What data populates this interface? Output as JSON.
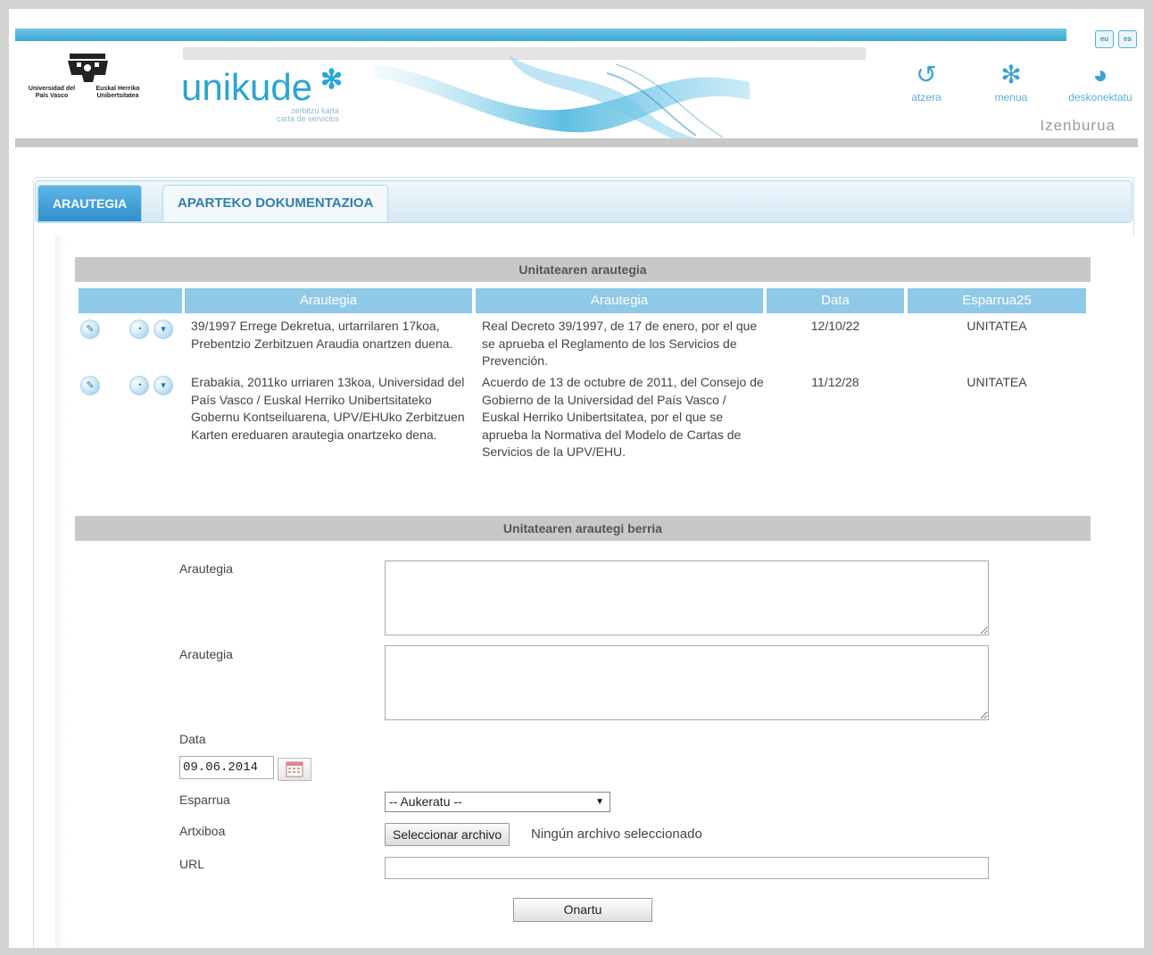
{
  "header": {
    "brand": "unikude",
    "brand_sub_1": "zerbitzu karta",
    "brand_sub_2": "carta de servicios",
    "ehu_text_1": "Universidad del País Vasco",
    "ehu_text_2": "Euskal Herriko Unibertsitatea",
    "lang_eu": "eu",
    "lang_es": "es",
    "nav": [
      {
        "label": "atzera",
        "icon": "back-arrow-icon"
      },
      {
        "label": "menua",
        "icon": "asterisk-menu-icon"
      },
      {
        "label": "deskonektatu",
        "icon": "globe-disconnect-icon"
      }
    ],
    "izenburua": "Izenburua",
    "accent": "#2aa5d5"
  },
  "tabs": [
    {
      "label": "ARAUTEGIA",
      "active": true
    },
    {
      "label": "APARTEKO DOKUMENTAZIOA",
      "active": false
    }
  ],
  "list": {
    "title": "Unitatearen arautegia",
    "columns": [
      "Arautegia",
      "Arautegia",
      "Data",
      "Esparrua25"
    ],
    "rows": [
      {
        "eu": "39/1997 Errege Dekretua, urtarrilaren 17koa, Prebentzio Zerbitzuen Araudia onartzen duena.",
        "es": "Real Decreto 39/1997, de 17 de enero, por el que se aprueba el Reglamento de los Servicios de Prevención.",
        "date": "12/10/22",
        "scope": "UNITATEA"
      },
      {
        "eu": "Erabakia, 2011ko urriaren 13koa, Universidad del País Vasco / Euskal Herriko Unibertsitateko Gobernu Kontseiluarena, UPV/EHUko Zerbitzuen Karten ereduaren arautegia onartzeko dena.",
        "es": "Acuerdo de 13 de octubre de 2011, del Consejo de Gobierno de la Universidad del País Vasco / Euskal Herriko Unibertsitatea, por el que se aprueba la Normativa del Modelo de Cartas de Servicios de la UPV/EHU.",
        "date": "11/12/28",
        "scope": "UNITATEA"
      }
    ]
  },
  "form": {
    "title": "Unitatearen arautegi berria",
    "label_arautegia_1": "Arautegia",
    "label_arautegia_2": "Arautegia",
    "label_data": "Data",
    "date_value": "09.06.2014",
    "label_esparrua": "Esparrua",
    "select_value": "-- Aukeratu --",
    "label_artxiboa": "Artxiboa",
    "file_button": "Seleccionar archivo",
    "file_none": "Ningún archivo seleccionado",
    "label_url": "URL",
    "submit": "Onartu"
  }
}
